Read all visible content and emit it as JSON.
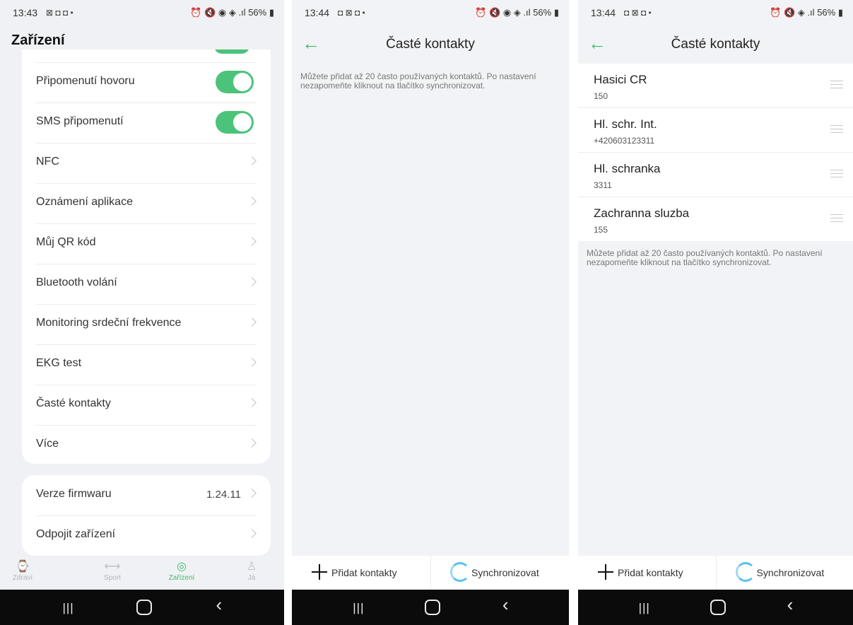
{
  "colors": {
    "accent": "#3bbd6b",
    "toggle_on": "#4cc37a",
    "sync_icon": "#5bc0f0"
  },
  "panel1": {
    "status": {
      "time": "13:43",
      "left_icons": "⊠ ◘ ◘ •",
      "right_icons": "⏰ 🔇 ◉ ◈ .ıl",
      "battery": "56%"
    },
    "title": "Zařízení",
    "settings": [
      {
        "label": "Připomenutí hovoru",
        "type": "toggle",
        "on": true
      },
      {
        "label": "SMS připomenutí",
        "type": "toggle",
        "on": true
      },
      {
        "label": "NFC",
        "type": "link"
      },
      {
        "label": "Oznámení aplikace",
        "type": "link"
      },
      {
        "label": "Můj QR kód",
        "type": "link"
      },
      {
        "label": "Bluetooth volání",
        "type": "link"
      },
      {
        "label": "Monitoring srdeční frekvence",
        "type": "link"
      },
      {
        "label": "EKG test",
        "type": "link"
      },
      {
        "label": "Časté kontakty",
        "type": "link"
      },
      {
        "label": "Více",
        "type": "link"
      }
    ],
    "firmware": {
      "label": "Verze firmwaru",
      "value": "1.24.11"
    },
    "disconnect": {
      "label": "Odpojit zařízení"
    },
    "tabs": [
      {
        "label": "Zdraví",
        "icon": "watch-icon",
        "active": false
      },
      {
        "label": "Sport",
        "icon": "dumbbell-icon",
        "active": false
      },
      {
        "label": "Zařízení",
        "icon": "device-icon",
        "active": true
      },
      {
        "label": "Já",
        "icon": "person-icon",
        "active": false
      }
    ]
  },
  "panel2": {
    "status": {
      "time": "13:44",
      "left_icons": "◘ ⊠ ◘ •",
      "right_icons": "⏰ 🔇 ◉ ◈ .ıl",
      "battery": "56%"
    },
    "title": "Časté kontakty",
    "info": "Můžete přidat až 20 často používaných kontaktů. Po nastavení nezapomeňte kliknout na tlačítko synchronizovat.",
    "add_label": "Přidat kontakty",
    "sync_label": "Synchronizovat"
  },
  "panel3": {
    "status": {
      "time": "13:44",
      "left_icons": "◘ ⊠ ◘ •",
      "right_icons": "⏰ 🔇 ◈ .ıl",
      "battery": "56%"
    },
    "title": "Časté kontakty",
    "contacts": [
      {
        "name": "Hasici CR",
        "number": "150"
      },
      {
        "name": "Hl. schr. Int.",
        "number": "+420603123311"
      },
      {
        "name": "Hl. schranka",
        "number": "3311"
      },
      {
        "name": "Zachranna sluzba",
        "number": "155"
      }
    ],
    "info": "Můžete přidat až 20 často používaných kontaktů. Po nastavení nezapomeňte kliknout na tlačítko synchronizovat.",
    "add_label": "Přidat kontakty",
    "sync_label": "Synchronizovat"
  }
}
